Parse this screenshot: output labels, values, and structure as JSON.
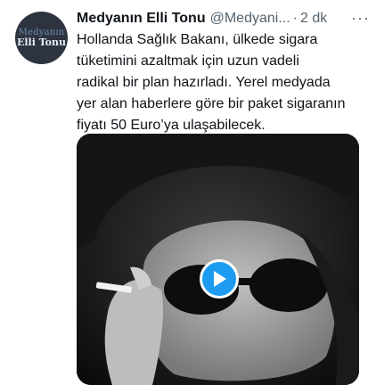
{
  "tweet": {
    "avatar": {
      "line1": "Medyanın",
      "line2": "Elli Tonu"
    },
    "author_name": "Medyanın Elli Tonu",
    "handle": "@Medyani...",
    "separator": "·",
    "time": "2 dk",
    "more_icon": "more-horizontal-icon",
    "text_lines": [
      "Hollanda Sağlık Bakanı, ülkede sigara",
      "tüketimini azaltmak için uzun vadeli",
      "radikal bir plan hazırladı. Yerel medyada",
      "yer alan haberlere göre bir paket sigaranın",
      "fiyatı 50 Euro’ya ulaşabilecek."
    ],
    "media": {
      "type": "video",
      "play_icon": "play-icon"
    }
  },
  "colors": {
    "text": "#0f1419",
    "secondary": "#536471",
    "accent": "#1d9bf0"
  }
}
